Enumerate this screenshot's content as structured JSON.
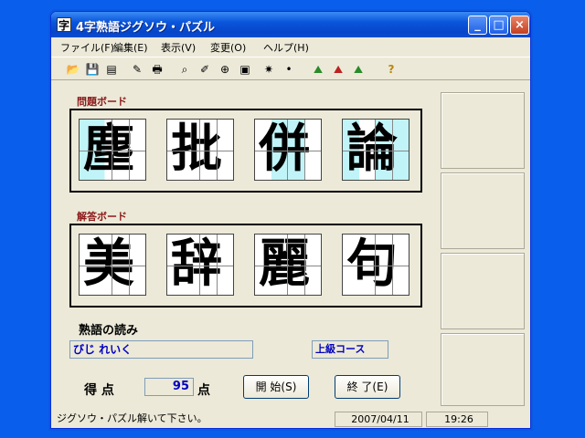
{
  "window": {
    "title": "4字熟語ジグソウ・パズル",
    "icon_glyph": "字",
    "minimize": "_",
    "maximize": "□",
    "close": "×"
  },
  "menu": [
    "ファイル(F)",
    "編集(E)",
    "表示(V)",
    "変更(O)",
    "ヘルプ(H)"
  ],
  "toolbar_icons": [
    "open-folder-icon",
    "save-icon",
    "list-icon",
    "edit-icon",
    "print-icon",
    "binoculars-icon",
    "brush-icon",
    "globe-icon",
    "stamp-icon",
    "star-icon",
    "dot-icon",
    "grass-icon",
    "grass-red-icon",
    "grass-green-icon",
    "help-icon"
  ],
  "toolbar_glyphs": [
    "📂",
    "💾",
    "▤",
    "✎",
    "🖶",
    "⌕",
    "✐",
    "⊕",
    "▣",
    "✷",
    "•",
    "⛰",
    "⛰",
    "⛰",
    "?"
  ],
  "problem_board": {
    "label": "問題ボード",
    "glyphs": [
      "塵",
      "批",
      "併",
      "論"
    ]
  },
  "answer_board": {
    "label": "解答ボード",
    "glyphs": [
      "美",
      "辞",
      "麗",
      "句"
    ]
  },
  "reading": {
    "label": "熟語の読み",
    "value": "びじ れいく"
  },
  "course": "上級コース",
  "score": {
    "label": "得 点",
    "value": "95",
    "unit": "点"
  },
  "buttons": {
    "start": "開 始(S)",
    "end": "終 了(E)"
  },
  "status": {
    "message": "ジグソウ・パズル解いて下さい。",
    "date": "2007/04/11",
    "time": "19:26"
  },
  "colors": {
    "tile_highlight": "#c0f4f8",
    "label": "#8b1a1a"
  }
}
